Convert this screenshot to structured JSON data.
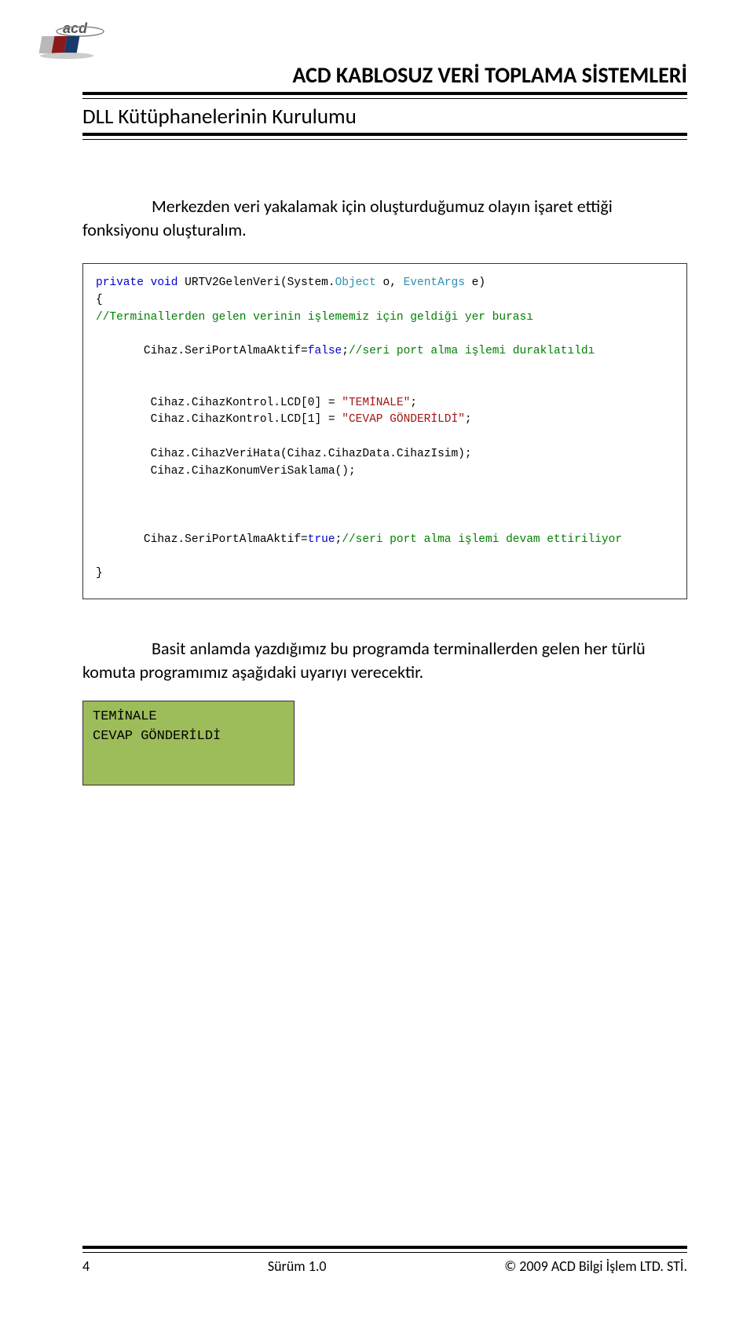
{
  "header": {
    "company_title": "ACD KABLOSUZ VERİ TOPLAMA SİSTEMLERİ",
    "sub_heading": "DLL Kütüphanelerinin Kurulumu"
  },
  "body": {
    "para1": "Merkezden veri yakalamak için oluşturduğumuz olayın işaret ettiği fonksiyonu oluşturalım.",
    "para2": "Basit anlamda yazdığımız bu programda terminallerden gelen her türlü komuta programımız aşağıdaki uyarıyı verecektir."
  },
  "code": {
    "l1a": "private",
    "l1b": " void",
    "l1c": " URTV2GelenVeri(System.",
    "l1d": "Object",
    "l1e": " o, ",
    "l1f": "EventArgs",
    "l1g": " e)",
    "l2": "{",
    "l3": "//Terminallerden gelen verinin işlememiz için geldiği yer burası",
    "l4a": "       Cihaz.SeriPortAlmaAktif=",
    "l4b": "false",
    "l4c": ";",
    "l4d": "//seri port alma işlemi duraklatıldı",
    "l5a": "        Cihaz.CihazKontrol.LCD[0] = ",
    "l5b": "\"TEMİNALE\"",
    "l5c": ";",
    "l6a": "        Cihaz.CihazKontrol.LCD[1] = ",
    "l6b": "\"CEVAP GÖNDERİLDİ\"",
    "l6c": ";",
    "l7": "        Cihaz.CihazVeriHata(Cihaz.CihazData.CihazIsim);",
    "l8": "        Cihaz.CihazKonumVeriSaklama();",
    "l9a": "       Cihaz.SeriPortAlmaAktif=",
    "l9b": "true",
    "l9c": ";",
    "l9d": "//seri port alma işlemi devam ettiriliyor",
    "l10": "}"
  },
  "terminal": {
    "line1": "TEMİNALE",
    "line2": "CEVAP GÖNDERİLDİ"
  },
  "footer": {
    "page_no": "4",
    "version": "Sürüm 1.0",
    "copyright": "© 2009 ACD Bilgi İşlem LTD. STİ."
  }
}
